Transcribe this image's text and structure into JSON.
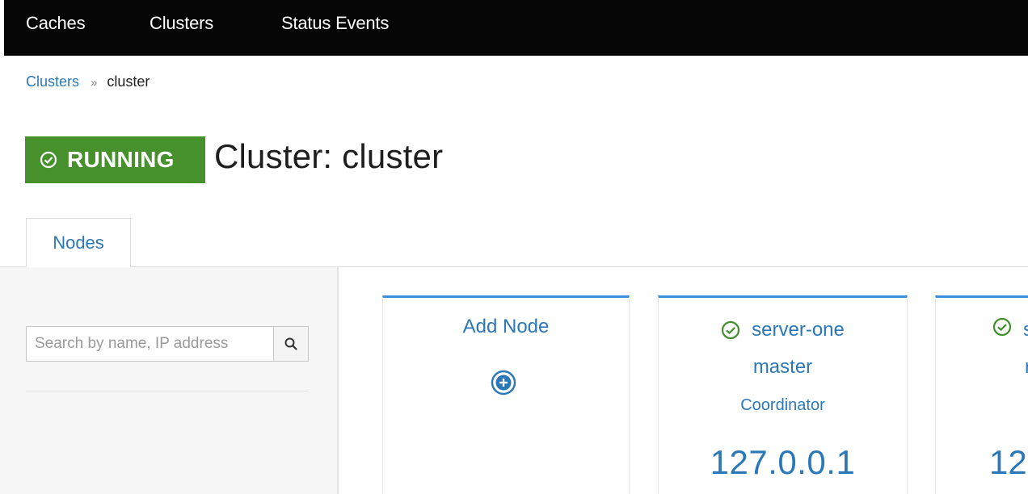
{
  "topnav": {
    "items": [
      {
        "label": "Caches"
      },
      {
        "label": "Clusters"
      },
      {
        "label": "Status Events"
      }
    ]
  },
  "breadcrumb": {
    "parent": "Clusters",
    "separator": "»",
    "current": "cluster"
  },
  "header": {
    "status": "RUNNING",
    "title": "Cluster: cluster"
  },
  "tabs": [
    {
      "label": "Nodes",
      "active": true
    }
  ],
  "search": {
    "placeholder": "Search by name, IP address",
    "value": ""
  },
  "cards": {
    "add_node": {
      "label": "Add Node"
    },
    "nodes": [
      {
        "name": "server-one",
        "group": "master",
        "role": "Coordinator",
        "ip": "127.0.0.1",
        "status": "ok"
      },
      {
        "name": "s",
        "group": "r",
        "role": "",
        "ip": "12",
        "status": "ok"
      }
    ]
  },
  "colors": {
    "nav_bg": "#050505",
    "link": "#2b78b8",
    "running_badge": "#47912d",
    "card_accent": "#3e8ddd",
    "status_ok": "#3f8f2a"
  },
  "icons": {
    "status": "check-circle-icon",
    "search": "search-icon",
    "add": "plus-circle-icon"
  }
}
